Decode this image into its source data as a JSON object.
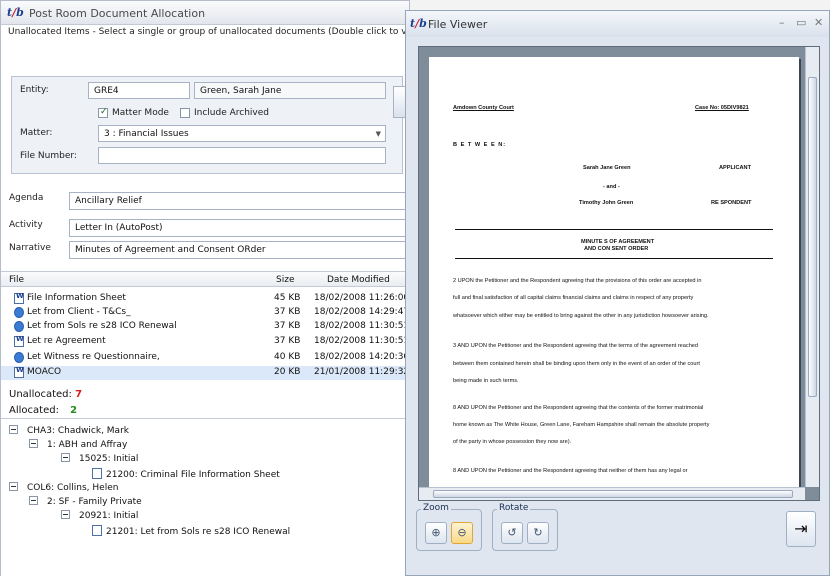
{
  "main_window": {
    "title": "Post Room Document Allocation",
    "instructions": "Unallocated Items - Select a single or group of unallocated documents (Double click to vie",
    "entity": {
      "label": "Entity:",
      "code": "GRE4",
      "name": "Green, Sarah Jane"
    },
    "matter_mode": {
      "label": "Matter Mode",
      "checked": true
    },
    "include_archived": {
      "label": "Include Archived",
      "checked": false
    },
    "matter": {
      "label": "Matter:",
      "value": "3 : Financial Issues"
    },
    "file_number": {
      "label": "File Number:",
      "value": ""
    },
    "agenda": {
      "label": "Agenda",
      "value": "Ancillary Relief"
    },
    "activity": {
      "label": "Activity",
      "value": "Letter In (AutoPost)"
    },
    "narrative": {
      "label": "Narrative",
      "value": "Minutes of Agreement and Consent ORder"
    },
    "file_list": {
      "columns": {
        "file": "File",
        "size": "Size",
        "date": "Date Modified"
      },
      "rows": [
        {
          "name": "File Information Sheet",
          "size": "45 KB",
          "date": "18/02/2008 11:26:00",
          "icon": "word-doc-icon"
        },
        {
          "name": "Let from Client - T&Cs_",
          "size": "37 KB",
          "date": "18/02/2008 14:29:47",
          "icon": "email-icon"
        },
        {
          "name": "Let from Sols re s28 ICO Renewal",
          "size": "37 KB",
          "date": "18/02/2008 11:30:51",
          "icon": "email-icon"
        },
        {
          "name": "Let re Agreement",
          "size": "37 KB",
          "date": "18/02/2008 11:30:51",
          "icon": "word-doc-icon"
        },
        {
          "name": "Let Witness re Questionnaire,",
          "size": "40 KB",
          "date": "18/02/2008 14:20:36",
          "icon": "email-icon"
        },
        {
          "name": "MOACO",
          "size": "20 KB",
          "date": "21/01/2008 11:29:32",
          "icon": "word-doc-icon"
        }
      ]
    },
    "unallocated": {
      "label": "Unallocated:",
      "count": "7",
      "color": "#d42020"
    },
    "allocated": {
      "label": "Allocated:",
      "count": "2",
      "color": "#1f8a1f"
    },
    "tree": [
      {
        "text": "CHA3: Chadwick, Mark",
        "type": "branch"
      },
      {
        "text": "1: ABH and Affray",
        "type": "branch"
      },
      {
        "text": "15025: Initial",
        "type": "branch"
      },
      {
        "text": "21200: Criminal File Information Sheet",
        "type": "leaf"
      },
      {
        "text": "COL6: Collins, Helen",
        "type": "branch"
      },
      {
        "text": "2: SF - Family Private",
        "type": "branch"
      },
      {
        "text": "20921: Initial",
        "type": "branch"
      },
      {
        "text": "21201: Let from Sols re s28 ICO Renewal",
        "type": "leaf"
      }
    ]
  },
  "viewer": {
    "title": "File Viewer",
    "zoom_label": "Zoom",
    "rotate_label": "Rotate",
    "document": {
      "court": "Amdown County Court",
      "case_no": "Case No: 05DIV9821",
      "between": "B E T W E E N:",
      "applicant_name": "Sarah Jane Green",
      "applicant_role": "APPLICANT",
      "and": "- and -",
      "respondent_name": "Timothy John Green",
      "respondent_role": "RE SPONDENT",
      "heading1": "MINUTE S OF AGREEMENT",
      "heading2": "AND CON SENT ORDER",
      "p1": [
        "2 UPON the Petitioner and the Respondent agreeing that the provisions of this order are accepted in",
        "full and final satisfaction of all capital claims financial claims and claims in respect of any property",
        "whatsoever which either may be entitled to bring against the other in any jurisdiction howsoever arising."
      ],
      "p2": [
        "3 AND UPON the Petitioner and the Respondent agreeing that the terms of the agreement reached",
        "between them contained herein shall be binding upon them only in the event of an order of the court",
        "being made in such terms."
      ],
      "p3": [
        "8 AND UPON the Petitioner and the Respondent agreeing that the contents of the former matrimonial",
        "home known as The White House, Green Lane, Fareham Hampshire shall remain the absolute property",
        "of the party in whose possession they now are)."
      ],
      "p4": [
        "8 AND UPON the Petitioner and the Respondent agreeing that neither of them has any legal or"
      ]
    }
  }
}
